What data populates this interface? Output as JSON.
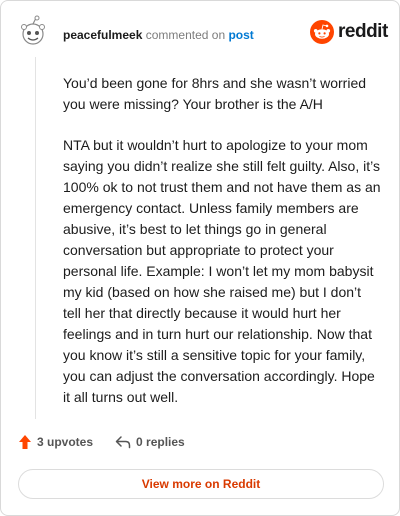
{
  "header": {
    "username": "peacefulmeek",
    "verb": "commented on",
    "post_link": "post",
    "logo_text": "reddit"
  },
  "comment": {
    "paragraphs": [
      "You’d been gone for 8hrs and she wasn’t worried you were missing? Your brother is the A/H",
      "NTA but it wouldn’t hurt to apologize to your mom saying you didn’t realize she still felt guilty. Also, it’s 100% ok to not trust them and not have them as an emergency contact. Unless family members are abusive, it’s best to let things go in general conversation but appropriate to protect your personal life. Example: I won’t let my mom babysit my kid (based on how she raised me) but I don’t tell her that directly because it would hurt her feelings and in turn hurt our relationship. Now that you know it’s still a sensitive topic for your family, you can adjust the conversation accordingly. Hope it all turns out well."
    ]
  },
  "actions": {
    "upvotes": "3 upvotes",
    "replies": "0 replies"
  },
  "view_more": "View more on Reddit",
  "colors": {
    "brand_orange": "#ff4500",
    "link_blue": "#0079d3",
    "view_more_text": "#d93a00"
  },
  "icons": [
    "avatar-icon",
    "reddit-logo-icon",
    "upvote-arrow-icon",
    "reply-arrow-icon"
  ]
}
